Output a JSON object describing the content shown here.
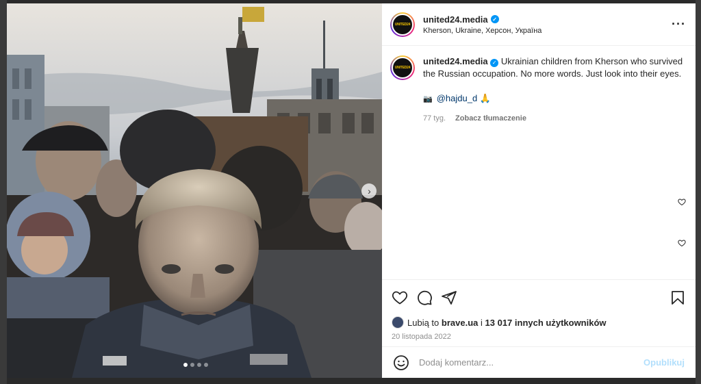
{
  "post": {
    "author": "united24.media",
    "location": "Kherson, Ukraine, Херсон, Україна",
    "avatar_text": "UNITED24",
    "more_icon": "more-horizontal-icon",
    "caption": {
      "author": "united24.media",
      "text": "Ukrainian children from Kherson who survived the Russian occupation. No more words. Just look into their eyes.",
      "camera_emoji": "📷",
      "credit_handle": "@hajdu_d",
      "credit_emoji": "🙏",
      "age": "77 tyg.",
      "translate": "Zobacz tłumaczenie"
    },
    "likes": {
      "prefix": "Lubią to",
      "user": "brave.ua",
      "joiner": "i",
      "others": "13 017 innych użytkowników"
    },
    "date": "20 listopada 2022",
    "comment_placeholder": "Dodaj komentarz...",
    "post_button": "Opublikuj"
  },
  "carousel": {
    "total_slides": 4,
    "current_slide": 1
  },
  "colors": {
    "verified": "#0095f6",
    "link": "#00376b",
    "post_disabled": "#b2dffc",
    "secondary_text": "#8e8e8e"
  }
}
